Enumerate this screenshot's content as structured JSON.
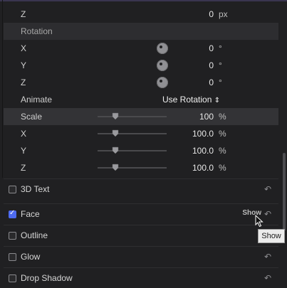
{
  "position": {
    "z": {
      "label": "Z",
      "value": "0",
      "unit": "px"
    }
  },
  "rotation": {
    "section_label": "Rotation",
    "rows": [
      {
        "label": "X",
        "value": "0",
        "unit": "°"
      },
      {
        "label": "Y",
        "value": "0",
        "unit": "°"
      },
      {
        "label": "Z",
        "value": "0",
        "unit": "°"
      }
    ],
    "animate_label": "Animate",
    "animate_value": "Use Rotation",
    "animate_chevron": "⌃⌄"
  },
  "scale": {
    "label": "Scale",
    "value": "100",
    "unit": "%",
    "rows": [
      {
        "label": "X",
        "value": "100.0",
        "unit": "%"
      },
      {
        "label": "Y",
        "value": "100.0",
        "unit": "%"
      },
      {
        "label": "Z",
        "value": "100.0",
        "unit": "%"
      }
    ]
  },
  "checks": [
    {
      "label": "3D Text",
      "checked": false
    },
    {
      "label": "Face",
      "checked": true,
      "show": "Show"
    },
    {
      "label": "Outline",
      "checked": false
    },
    {
      "label": "Glow",
      "checked": false
    },
    {
      "label": "Drop Shadow",
      "checked": false
    }
  ],
  "tooltip": "Show",
  "colors": {
    "accent": "#4e6bf0",
    "background": "#202022",
    "section": "#2d2d30"
  }
}
